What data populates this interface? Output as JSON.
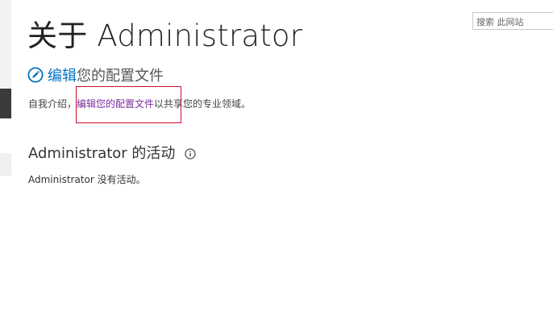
{
  "page": {
    "title": "关于 Administrator"
  },
  "search": {
    "placeholder": "搜索 此网站"
  },
  "profile": {
    "edit_heading_part1": "编辑",
    "edit_heading_part2": "您的配置文件",
    "bio_prefix": "自我介绍，",
    "bio_link": "编辑您的配置文件",
    "bio_suffix": "以共享您的专业领域。"
  },
  "activity": {
    "heading": "Administrator 的活动",
    "empty_message": "Administrator 没有活动。"
  },
  "icons": {
    "edit": "pencil-circle-icon",
    "info": "info-icon"
  },
  "colors": {
    "link_blue": "#0072c6",
    "visited_link_purple": "#7a2e9e",
    "highlight_red": "#c8102e"
  }
}
